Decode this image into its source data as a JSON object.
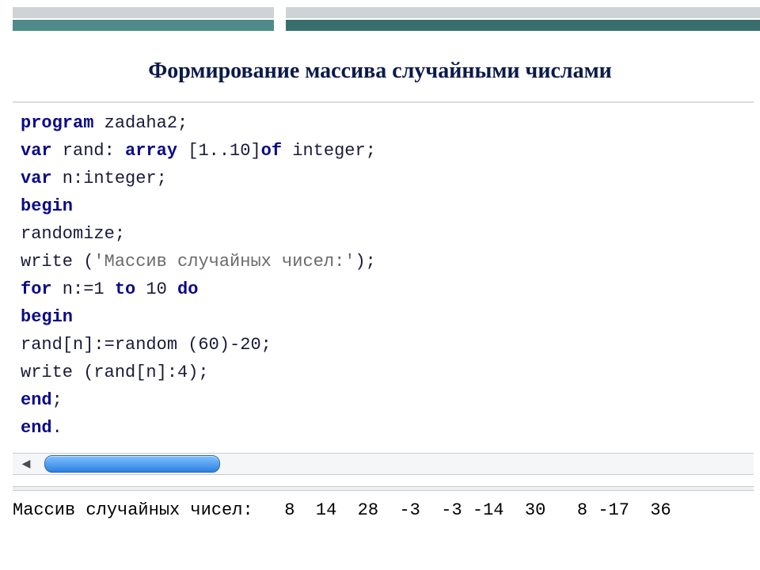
{
  "title": "Формирование массива случайными числами",
  "code": {
    "l1_kw": "program",
    "l1_rest": " zadaha2;",
    "l2_kw1": "var",
    "l2_mid": " rand: ",
    "l2_kw2": "array",
    "l2_after": " [1..10]",
    "l2_kw3": "of",
    "l2_end": " integer;",
    "l3_kw": "var",
    "l3_rest": " n:integer;",
    "l4_kw": "begin",
    "l5": "randomize;",
    "l6_pre": "write (",
    "l6_str": "'Массив случайных чисел:'",
    "l6_post": ");",
    "l7_kw1": "for",
    "l7_mid1": " n:=1 ",
    "l7_kw2": "to",
    "l7_mid2": " 10 ",
    "l7_kw3": "do",
    "l8_kw": "begin",
    "l9": "rand[n]:=random (60)-20;",
    "l10": "write (rand[n]:4);",
    "l11_kw": "end",
    "l11_post": ";",
    "l12_kw": "end",
    "l12_post": "."
  },
  "output": {
    "label": "Массив случайных чисел:",
    "values": [
      8,
      14,
      28,
      -3,
      -3,
      -14,
      30,
      8,
      -17,
      36
    ],
    "line": "Массив случайных чисел:   8  14  28  -3  -3 -14  30   8 -17  36"
  }
}
